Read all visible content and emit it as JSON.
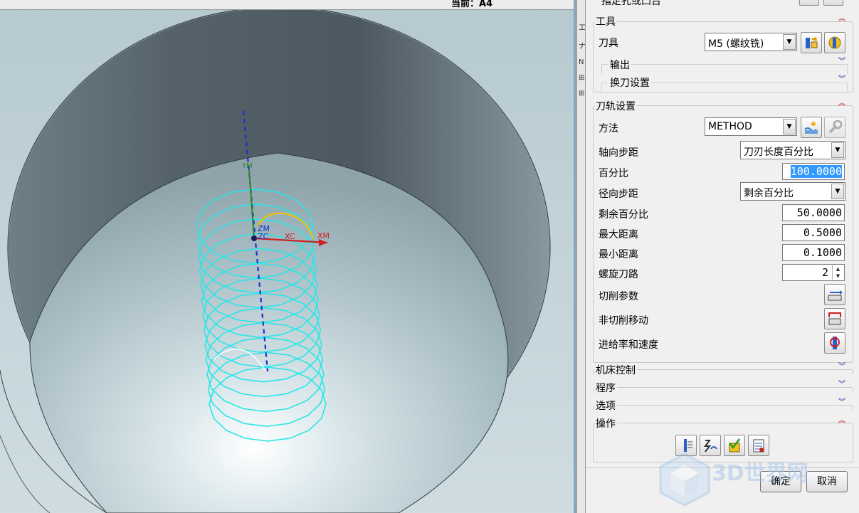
{
  "viewport": {
    "current_label": "当前：A4",
    "axis_labels": {
      "zm": "ZM",
      "zc": "ZC",
      "xc": "XC",
      "xm": "XM",
      "y": "YM"
    }
  },
  "side_strip": {
    "glyphs": [
      "工",
      "ナ",
      "N",
      "⊞",
      "⊞"
    ]
  },
  "dialog": {
    "top_cut_label": "指定孔或凸台",
    "tool_group": {
      "title": "工具",
      "tool_label": "刀具",
      "tool_value": "M5 (螺纹铣)",
      "output_label": "输出",
      "tool_change_label": "换刀设置"
    },
    "path_group": {
      "title": "刀轨设置",
      "method_label": "方法",
      "method_value": "METHOD",
      "axial_step_label": "轴向步距",
      "axial_step_value": "刀刃长度百分比",
      "percent_label": "百分比",
      "percent_value": "100.0000",
      "radial_step_label": "径向步距",
      "radial_step_value": "剩余百分比",
      "remaining_percent_label": "剩余百分比",
      "remaining_percent_value": "50.0000",
      "max_distance_label": "最大距离",
      "max_distance_value": "0.5000",
      "min_distance_label": "最小距离",
      "min_distance_value": "0.1000",
      "helical_passes_label": "螺旋刀路",
      "helical_passes_value": "2",
      "cut_params_label": "切削参数",
      "non_cut_label": "非切削移动",
      "feeds_label": "进给率和速度"
    },
    "collapsed": {
      "machine_control": "机床控制",
      "program": "程序",
      "options": "选项"
    },
    "actions_group": {
      "title": "操作"
    },
    "ok_label": "确定",
    "cancel_label": "取消",
    "watermark": "3D世界网"
  },
  "colors": {
    "helix": "#29e6e6",
    "tool_axis": "#1a2fd0",
    "collapse_up": "#c02020",
    "expand_down": "#1a2fa8",
    "selection": "#3399ff"
  }
}
